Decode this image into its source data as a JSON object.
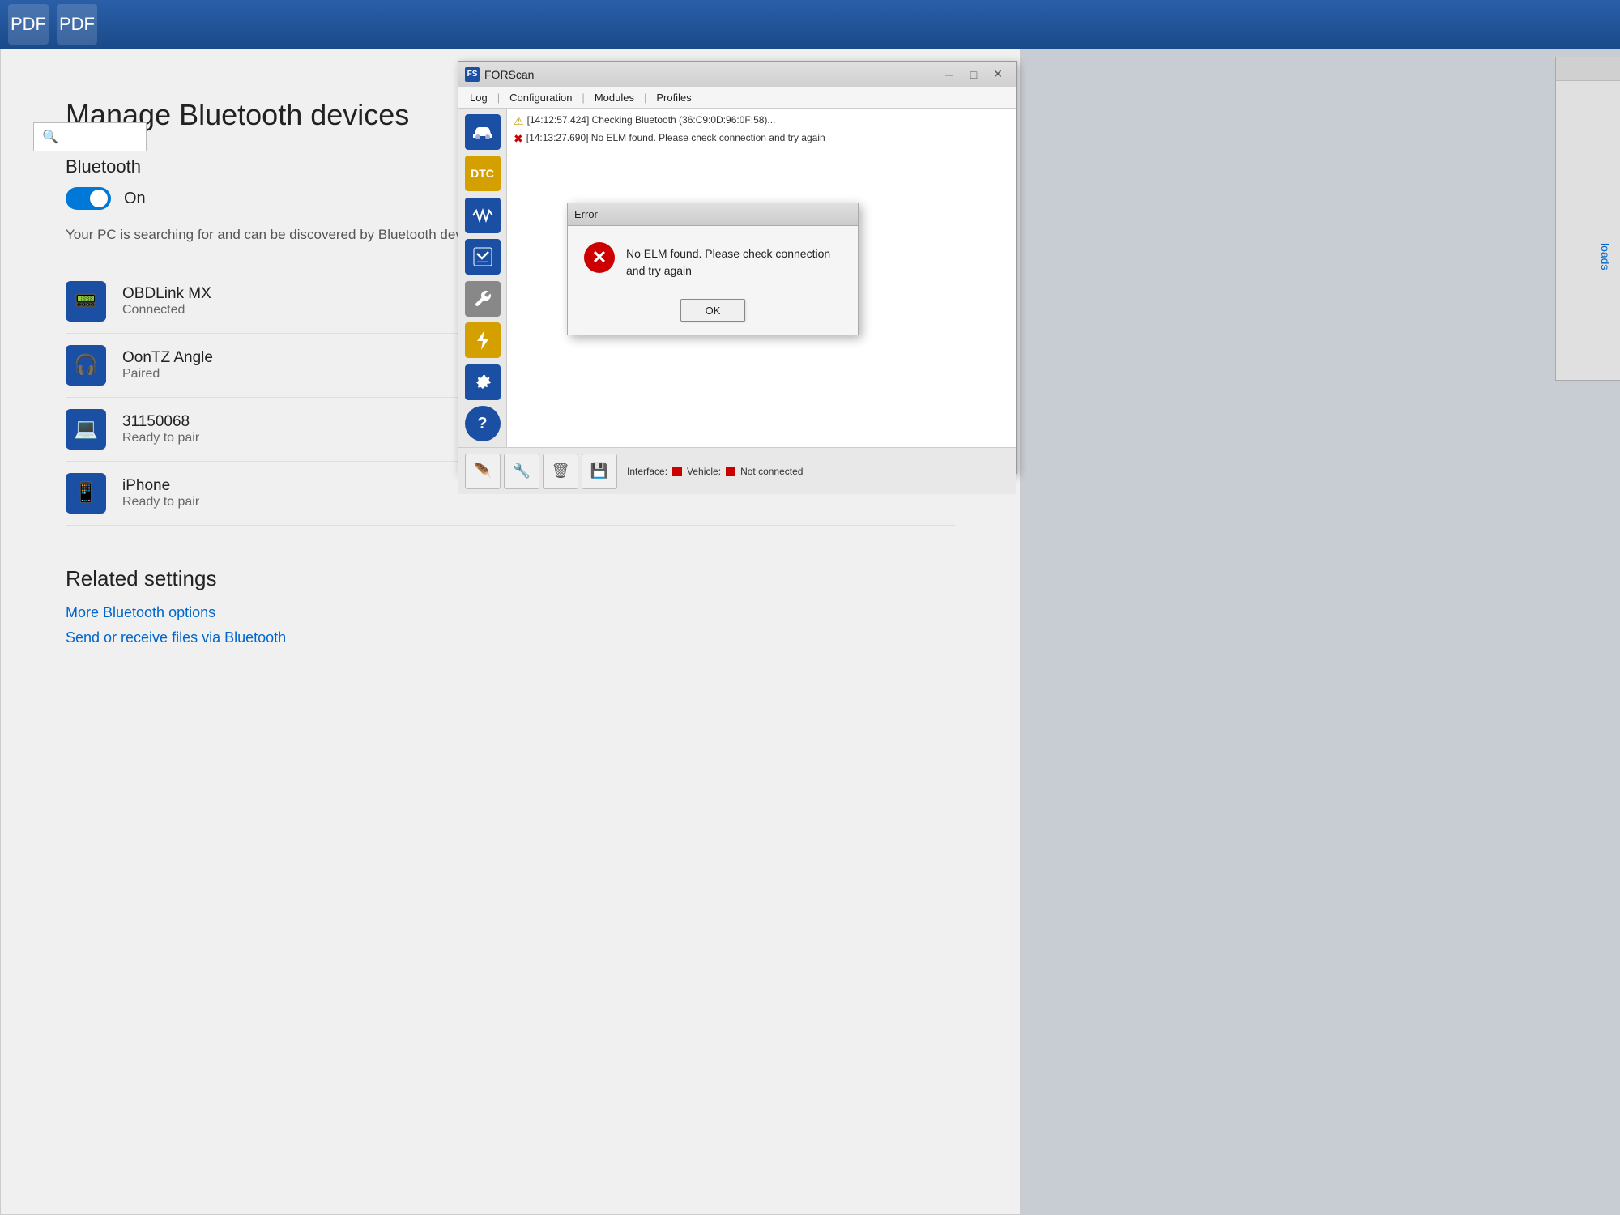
{
  "topbar": {
    "icons": [
      "PDF",
      "PDF"
    ]
  },
  "settings": {
    "title": "Manage Bluetooth devices",
    "bluetooth_label": "Bluetooth",
    "toggle_state": "On",
    "description": "Your PC is searching for and can be discovered by Bluetooth devices.",
    "devices": [
      {
        "name": "OBDLink MX",
        "status": "Connected",
        "icon": "monitor"
      },
      {
        "name": "OonTZ Angle",
        "status": "Paired",
        "icon": "headphone"
      },
      {
        "name": "31150068",
        "status": "Ready to pair",
        "icon": "laptop"
      },
      {
        "name": "iPhone",
        "status": "Ready to pair",
        "icon": "phone"
      }
    ],
    "related_settings_title": "Related settings",
    "related_links": [
      "More Bluetooth options",
      "Send or receive files via Bluetooth"
    ]
  },
  "forscan": {
    "title": "FORScan",
    "title_icon": "FS",
    "menu_items": [
      "Log",
      "Configuration",
      "Modules",
      "Profiles"
    ],
    "log_lines": [
      {
        "type": "warn",
        "text": "[14:12:57.424] Checking Bluetooth (36:C9:0D:96:0F:58)..."
      },
      {
        "type": "error",
        "text": "[14:13:27.690] No ELM found. Please check connection and try again"
      }
    ],
    "sidebar_icons": [
      "car",
      "dtc",
      "wave",
      "check",
      "wrench",
      "bolt",
      "gear",
      "help"
    ],
    "bottom_buttons": [
      "feather",
      "wrench2",
      "trash",
      "save"
    ],
    "status": {
      "interface_label": "Interface:",
      "vehicle_label": "Vehicle:",
      "connection_status": "Not connected",
      "interface_dot": "red",
      "vehicle_dot": "red"
    }
  },
  "error_dialog": {
    "title": "Error",
    "icon": "✕",
    "message": "No ELM found. Please check connection and try again",
    "ok_label": "OK"
  },
  "second_window": {
    "partial_text": "loads"
  }
}
